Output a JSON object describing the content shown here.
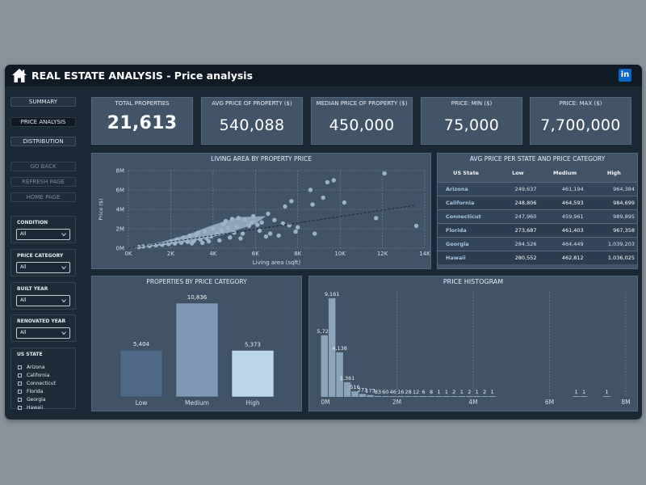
{
  "header": {
    "title": "REAL ESTATE ANALYSIS - Price analysis",
    "linkedin_label": "in"
  },
  "nav": {
    "summary": "SUMMARY",
    "price_analysis": "PRICE ANALYSIS",
    "distribution": "DISTRIBUTION",
    "go_back": "GO BACK",
    "refresh": "REFRESH PAGE",
    "home": "HOME PAGE"
  },
  "filters": {
    "condition": {
      "label": "CONDITION",
      "value": "All"
    },
    "price_category": {
      "label": "PRICE CATEGORY",
      "value": "All"
    },
    "built_year": {
      "label": "BUILT YEAR",
      "value": "All"
    },
    "renovated_year": {
      "label": "RENOVATED YEAR",
      "value": "All"
    },
    "us_state": {
      "label": "US STATE",
      "options": [
        "Arizona",
        "California",
        "Connecticut",
        "Florida",
        "Georgia",
        "Hawaii"
      ]
    }
  },
  "kpis": {
    "total": {
      "label": "TOTAL PROPERTIES",
      "value": "21,613"
    },
    "avg": {
      "label": "AVG PRICE OF PROPERTY ($)",
      "value": "540,088"
    },
    "median": {
      "label": "MEDIAN PRICE OF PROPERTY ($)",
      "value": "450,000"
    },
    "min": {
      "label": "PRICE: MIN ($)",
      "value": "75,000"
    },
    "max": {
      "label": "PRICE: MAX ($)",
      "value": "7,700,000"
    }
  },
  "scatter_title": "LIVING AREA BY PROPERTY PRICE",
  "table": {
    "title": "AVG PRICE PER STATE AND PRICE CATEGORY",
    "headers": [
      "US State",
      "Low",
      "Medium",
      "High"
    ],
    "rows": [
      [
        "Arizona",
        "249,637",
        "461,194",
        "964,384"
      ],
      [
        "California",
        "248,806",
        "464,593",
        "984,699"
      ],
      [
        "Connecticut",
        "247,960",
        "459,961",
        "989,895"
      ],
      [
        "Florida",
        "273,687",
        "461,403",
        "967,358"
      ],
      [
        "Georgia",
        "284,526",
        "464,449",
        "1,039,203"
      ],
      [
        "Hawaii",
        "280,552",
        "462,812",
        "1,036,025"
      ]
    ]
  },
  "bar_title": "PROPERTIES BY PRICE CATEGORY",
  "hist_title": "PRICE HISTOGRAM",
  "colors": {
    "background": "#1b2835",
    "panel": "#405367",
    "low": "#4e6a88",
    "medium": "#7f9ab4",
    "high": "#b9d6ea",
    "scatter": "#9bb3c9",
    "histogram": "#8ba3bb"
  },
  "chart_data": [
    {
      "type": "scatter",
      "title": "LIVING AREA BY PROPERTY PRICE",
      "xlabel": "Living area (sqft)",
      "ylabel": "Price ($)",
      "xlim": [
        0,
        14000
      ],
      "ylim": [
        0,
        8000000
      ],
      "xticks": [
        "0K",
        "2K",
        "4K",
        "6K",
        "8K",
        "10K",
        "12K",
        "14K"
      ],
      "yticks": [
        "0M",
        "2M",
        "4M",
        "6M",
        "8M"
      ],
      "trendline": [
        [
          0,
          0
        ],
        [
          13500,
          4400000
        ]
      ],
      "points": [
        [
          7400,
          4300000
        ],
        [
          7700,
          4850000
        ],
        [
          9400,
          6800000
        ],
        [
          9700,
          7000000
        ],
        [
          12100,
          7700000
        ],
        [
          13600,
          2300000
        ],
        [
          8700,
          4500000
        ],
        [
          9200,
          5200000
        ],
        [
          10200,
          4700000
        ],
        [
          11700,
          3100000
        ],
        [
          6600,
          3550000
        ],
        [
          6900,
          2900000
        ],
        [
          7300,
          2550000
        ],
        [
          7600,
          2350000
        ],
        [
          8000,
          2150000
        ],
        [
          6300,
          2650000
        ],
        [
          6100,
          2400000
        ],
        [
          5800,
          2600000
        ],
        [
          5500,
          2900000
        ],
        [
          5700,
          2300000
        ],
        [
          6200,
          1800000
        ],
        [
          6700,
          1500000
        ],
        [
          5400,
          1500000
        ],
        [
          5000,
          1600000
        ],
        [
          4700,
          2100000
        ],
        [
          4400,
          1800000
        ],
        [
          4200,
          1500000
        ],
        [
          3900,
          1200000
        ],
        [
          3700,
          1000000
        ],
        [
          3400,
          900000
        ],
        [
          3100,
          750000
        ],
        [
          2800,
          650000
        ],
        [
          2500,
          560000
        ],
        [
          2200,
          480000
        ],
        [
          1900,
          420000
        ],
        [
          1600,
          350000
        ],
        [
          1300,
          290000
        ],
        [
          1000,
          230000
        ],
        [
          700,
          180000
        ],
        [
          500,
          120000
        ],
        [
          3200,
          1400000
        ],
        [
          3600,
          1700000
        ],
        [
          4000,
          2000000
        ],
        [
          4500,
          2500000
        ],
        [
          5100,
          2200000
        ],
        [
          2600,
          1100000
        ],
        [
          2900,
          1300000
        ],
        [
          3300,
          1600000
        ],
        [
          2300,
          900000
        ],
        [
          2000,
          700000
        ],
        [
          4800,
          1100000
        ],
        [
          5300,
          1000000
        ],
        [
          4300,
          800000
        ],
        [
          3800,
          700000
        ],
        [
          3500,
          550000
        ],
        [
          6500,
          1200000
        ],
        [
          7100,
          1300000
        ],
        [
          7900,
          1700000
        ],
        [
          8800,
          1500000
        ],
        [
          5900,
          3300000
        ],
        [
          5200,
          3100000
        ],
        [
          4900,
          3000000
        ],
        [
          8600,
          6000000
        ],
        [
          4600,
          2800000
        ],
        [
          3000,
          500000
        ]
      ]
    },
    {
      "type": "bar",
      "title": "PROPERTIES BY PRICE CATEGORY",
      "categories": [
        "Low",
        "Medium",
        "High"
      ],
      "values": [
        5404,
        10836,
        5373
      ],
      "labels": [
        "5,404",
        "10,836",
        "5,373"
      ]
    },
    {
      "type": "bar",
      "title": "PRICE HISTOGRAM",
      "xlim": [
        0,
        8000000
      ],
      "xticks": [
        "0M",
        "2M",
        "4M",
        "6M",
        "8M"
      ],
      "bins": [
        {
          "x": 0,
          "value": 5722
        },
        {
          "x": 200000,
          "value": 9161
        },
        {
          "x": 400000,
          "value": 4138
        },
        {
          "x": 600000,
          "value": 1361
        },
        {
          "x": 800000,
          "value": 516
        },
        {
          "x": 1000000,
          "value": 271
        },
        {
          "x": 1200000,
          "value": 173
        },
        {
          "x": 1400000,
          "value": 83
        },
        {
          "x": 1600000,
          "value": 60
        },
        {
          "x": 1800000,
          "value": 46
        },
        {
          "x": 2000000,
          "value": 16
        },
        {
          "x": 2200000,
          "value": 28
        },
        {
          "x": 2400000,
          "value": 12
        },
        {
          "x": 2600000,
          "value": 6
        },
        {
          "x": 2800000,
          "value": 8
        },
        {
          "x": 3000000,
          "value": 1
        },
        {
          "x": 3200000,
          "value": 1
        },
        {
          "x": 3400000,
          "value": 2
        },
        {
          "x": 3600000,
          "value": 1
        },
        {
          "x": 3800000,
          "value": 2
        },
        {
          "x": 4000000,
          "value": 1
        },
        {
          "x": 4200000,
          "value": 2
        },
        {
          "x": 4400000,
          "value": 1
        },
        {
          "x": 6600000,
          "value": 1
        },
        {
          "x": 6800000,
          "value": 1
        },
        {
          "x": 7400000,
          "value": 1
        }
      ]
    }
  ]
}
